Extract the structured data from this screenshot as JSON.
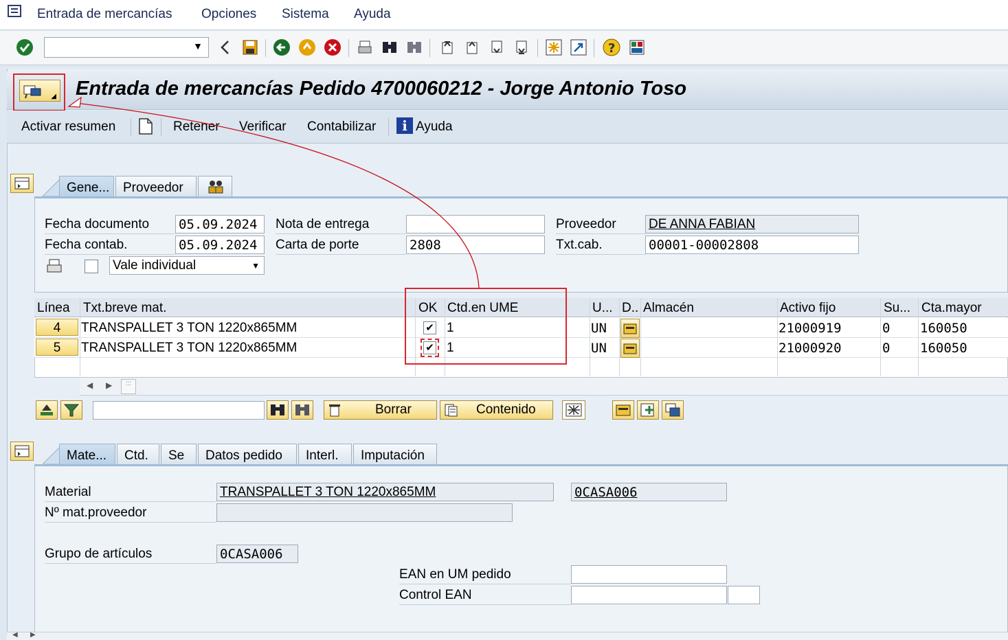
{
  "menu": {
    "items": [
      {
        "label": "Entrada de mercancías"
      },
      {
        "label": "Opciones"
      },
      {
        "label": "Sistema"
      },
      {
        "label": "Ayuda"
      }
    ]
  },
  "toolbar": {
    "command_value": ""
  },
  "screen": {
    "title": "Entrada de mercancías Pedido 4700060212 - Jorge Antonio Toso"
  },
  "appbar": {
    "activar_resumen": "Activar resumen",
    "retener": "Retener",
    "verificar": "Verificar",
    "contabilizar": "Contabilizar",
    "ayuda": "Ayuda"
  },
  "header_tabs": [
    "Gene...",
    "Proveedor"
  ],
  "header": {
    "fecha_documento_label": "Fecha documento",
    "fecha_documento": "05.09.2024",
    "fecha_contab_label": "Fecha contab.",
    "fecha_contab": "05.09.2024",
    "nota_entrega_label": "Nota de entrega",
    "nota_entrega": "",
    "carta_porte_label": "Carta de porte",
    "carta_porte": "2808",
    "proveedor_label": "Proveedor",
    "proveedor": "DE ANNA FABIAN",
    "txt_cab_label": "Txt.cab.",
    "txt_cab": "00001-00002808",
    "vale": "Vale individual"
  },
  "table": {
    "columns": [
      "Línea",
      "Txt.breve mat.",
      "OK",
      "Ctd.en UME",
      "U...",
      "D..",
      "Almacén",
      "Activo fijo",
      "Su...",
      "Cta.mayor"
    ],
    "rows": [
      {
        "linea": "4",
        "txt": "TRANSPALLET 3 TON 1220x865MM",
        "ok": true,
        "ctd": "1",
        "um": "UN",
        "almacen": "",
        "activo": "21000919",
        "su": "0",
        "cta": "160050"
      },
      {
        "linea": "5",
        "txt": "TRANSPALLET 3 TON 1220x865MM",
        "ok": true,
        "ctd": "1",
        "um": "UN",
        "almacen": "",
        "activo": "21000920",
        "su": "0",
        "cta": "160050"
      }
    ]
  },
  "table_toolbar": {
    "search_value": "",
    "borrar": "Borrar",
    "contenido": "Contenido"
  },
  "detail_tabs": [
    "Mate...",
    "Ctd.",
    "Se",
    "Datos pedido",
    "Interl.",
    "Imputación"
  ],
  "detail": {
    "material_label": "Material",
    "material_text": "TRANSPALLET 3 TON 1220x865MM",
    "material_code": "0CASA006",
    "nro_mat_prov_label": "Nº mat.proveedor",
    "nro_mat_prov": "",
    "grupo_art_label": "Grupo de artículos",
    "grupo_art": "0CASA006",
    "ean_um_label": "EAN en UM pedido",
    "ean_um": "",
    "control_ean_label": "Control EAN",
    "control_ean": "",
    "control_ean2": ""
  }
}
